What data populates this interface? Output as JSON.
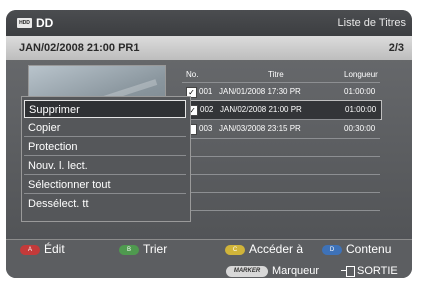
{
  "header": {
    "icon_label": "HDD",
    "app_name": "DD",
    "screen_title": "Liste de Titres"
  },
  "subbar": {
    "recording_info": "JAN/02/2008 21:00 PR1",
    "page_indicator": "2/3"
  },
  "table": {
    "columns": [
      "No.",
      "Titre",
      "Longueur"
    ],
    "rows": [
      {
        "checked": true,
        "no": "001",
        "title": "JAN/01/2008 17:30 PR",
        "length": "01:00:00",
        "selected": false
      },
      {
        "checked": true,
        "no": "002",
        "title": "JAN/02/2008 21:00 PR",
        "length": "01:00:00",
        "selected": true
      },
      {
        "checked": false,
        "no": "003",
        "title": "JAN/03/2008 23:15 PR",
        "length": "00:30:00",
        "selected": false
      }
    ]
  },
  "menu": {
    "items": [
      "Supprimer",
      "Copier",
      "Protection",
      "Nouv. l. lect.",
      "Sélectionner tout",
      "Dessélect. tt"
    ],
    "active_index": 0
  },
  "footer": {
    "row1": [
      {
        "key": "A",
        "label": "Édit"
      },
      {
        "key": "B",
        "label": "Trier"
      },
      {
        "key": "C",
        "label": "Accéder à"
      },
      {
        "key": "D",
        "label": "Contenu"
      }
    ],
    "marker_key": "MARKER",
    "marker_label": "Marqueur",
    "exit_label": "SORTIE"
  },
  "colors": {
    "key_red": "#c43a3a"
  }
}
